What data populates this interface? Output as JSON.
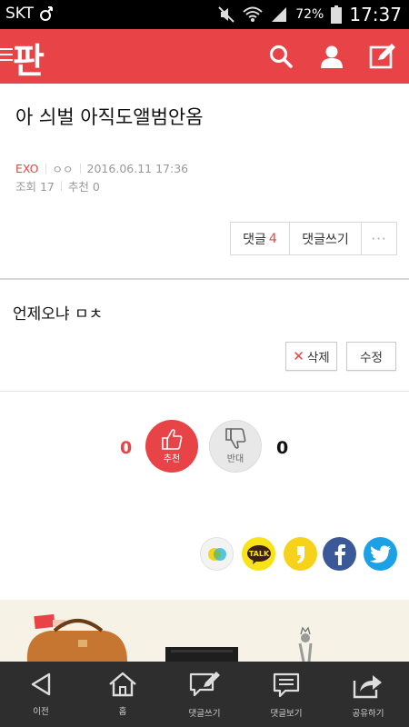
{
  "status_bar": {
    "carrier": "SKT",
    "battery": "72%",
    "time": "17:37"
  },
  "app_bar": {
    "logo": "판"
  },
  "post": {
    "title": "아 싀벌 아직도앨범안옴",
    "category": "EXO",
    "author": "ㅇㅇ",
    "date": "2016.06.11 17:36",
    "views_label": "조회 17",
    "recommend_label": "추천 0",
    "body": "언제오냐 ㅁㅊ"
  },
  "comment_buttons": {
    "comments_label": "댓글",
    "comments_count": "4",
    "write_comment_label": "댓글쓰기",
    "more_label": "···"
  },
  "actions": {
    "delete_label": "삭제",
    "edit_label": "수정"
  },
  "votes": {
    "up_count": "0",
    "up_label": "추천",
    "down_label": "반대",
    "down_count": "0"
  },
  "share_icons": [
    "kakaostory-icon",
    "kakaotalk-icon",
    "quote-icon",
    "facebook-icon",
    "twitter-icon"
  ],
  "bottom_nav": {
    "prev_label": "이전",
    "home_label": "홈",
    "write_comment_label": "댓글쓰기",
    "view_comments_label": "댓글보기",
    "share_label": "공유하기"
  },
  "colors": {
    "brand_red": "#e84447",
    "nav_bg": "#2e2e2e"
  }
}
